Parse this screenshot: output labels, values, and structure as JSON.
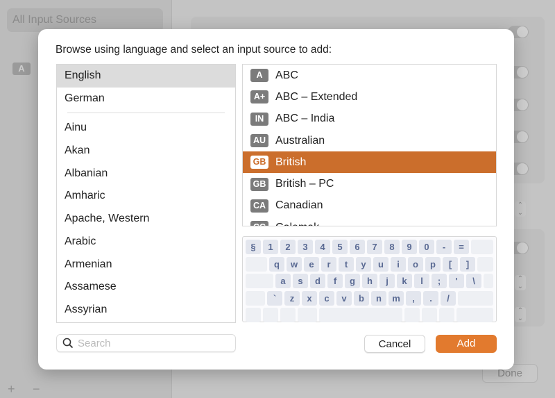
{
  "background": {
    "sidebar_item": "All Input Sources",
    "badge": "A",
    "done_label": "Done",
    "add_label": "+",
    "remove_label": "−"
  },
  "dialog": {
    "title": "Browse using language and select an input source to add:",
    "languages": [
      "English",
      "German",
      "Ainu",
      "Akan",
      "Albanian",
      "Amharic",
      "Apache, Western",
      "Arabic",
      "Armenian",
      "Assamese",
      "Assyrian"
    ],
    "selected_language": "English",
    "sources": [
      {
        "badge": "A",
        "label": "ABC"
      },
      {
        "badge": "A+",
        "label": "ABC – Extended"
      },
      {
        "badge": "IN",
        "label": "ABC – India"
      },
      {
        "badge": "AU",
        "label": "Australian"
      },
      {
        "badge": "GB",
        "label": "British",
        "selected": true
      },
      {
        "badge": "GB",
        "label": "British – PC"
      },
      {
        "badge": "CA",
        "label": "Canadian"
      },
      {
        "badge": "CC",
        "label": "Colemak"
      }
    ],
    "keyboard_rows": [
      [
        "§",
        "1",
        "2",
        "3",
        "4",
        "5",
        "6",
        "7",
        "8",
        "9",
        "0",
        "-",
        "="
      ],
      [
        "q",
        "w",
        "e",
        "r",
        "t",
        "y",
        "u",
        "i",
        "o",
        "p",
        "[",
        "]"
      ],
      [
        "a",
        "s",
        "d",
        "f",
        "g",
        "h",
        "j",
        "k",
        "l",
        ";",
        "'",
        "\\"
      ],
      [
        "`",
        "z",
        "x",
        "c",
        "v",
        "b",
        "n",
        "m",
        ",",
        ".",
        "/"
      ]
    ],
    "search_placeholder": "Search",
    "search_value": "",
    "cancel_label": "Cancel",
    "add_label": "Add",
    "accent": "#e27a2e",
    "selection_color": "#cb6e2c"
  }
}
